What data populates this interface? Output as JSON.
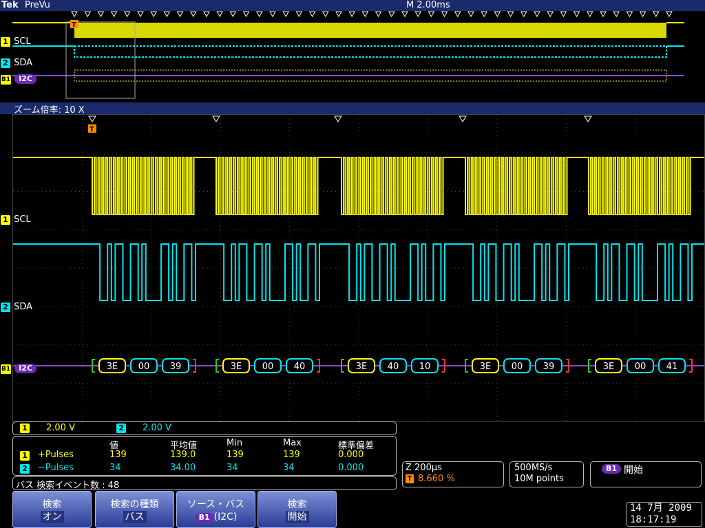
{
  "header": {
    "brand": "Tek",
    "mode": "PreVu",
    "timebase": "M 2.00ms"
  },
  "overview": {
    "ch1_label": "SCL",
    "ch2_label": "SDA",
    "bus_label": "I2C",
    "ch1_num": "1",
    "ch2_num": "2",
    "bus_num": "B1",
    "trigger_marker": "T"
  },
  "zoom": {
    "label": "ズーム倍率: 10 X"
  },
  "main": {
    "ch1_label": "SCL",
    "ch2_label": "SDA",
    "bus_label": "I2C",
    "ch1_num": "1",
    "ch2_num": "2",
    "bus_num": "B1",
    "trigger_marker": "T",
    "packets": [
      [
        "3E",
        "00",
        "39"
      ],
      [
        "3E",
        "00",
        "40"
      ],
      [
        "3E",
        "40",
        "10"
      ],
      [
        "3E",
        "00",
        "39"
      ],
      [
        "3E",
        "00",
        "41"
      ]
    ]
  },
  "scales": {
    "ch1_num": "1",
    "ch1_scale": "2.00 V",
    "ch2_num": "2",
    "ch2_scale": "2.00 V"
  },
  "stats": {
    "headers": {
      "value": "値",
      "mean": "平均値",
      "min": "Min",
      "max": "Max",
      "std": "標準偏差"
    },
    "rows": [
      {
        "num": "1",
        "name": "+Pulses",
        "value": "139",
        "mean": "139.0",
        "min": "139",
        "max": "139",
        "std": "0.000"
      },
      {
        "num": "2",
        "name": "−Pulses",
        "value": "34",
        "mean": "34.00",
        "min": "34",
        "max": "34",
        "std": "0.000"
      }
    ]
  },
  "search_events": "バス 検索イベント数 : 48",
  "zoom_box": {
    "z": "Z 200µs",
    "t_marker": "T",
    "t_pos": "8.660 %"
  },
  "sample_box": {
    "rate": "500MS/s",
    "points": "10M points"
  },
  "bus_box": {
    "bus": "B1",
    "state": "開始"
  },
  "buttons": [
    {
      "line1": "検索",
      "line2": "オン"
    },
    {
      "line1": "検索の種類",
      "line2": "バス"
    },
    {
      "line1": "ソース・バス",
      "bus": "B1",
      "line2": "(I2C)"
    },
    {
      "line1": "検索",
      "line2": "開始"
    }
  ],
  "datetime": {
    "date": "14 7月  2009",
    "time": "18:17:19"
  },
  "colors": {
    "ch1": "#ffff00",
    "ch2": "#00e5ee",
    "bus": "#8a4cd4",
    "trigger": "#ff8c00",
    "header": "#1a2a6a"
  },
  "icons": {
    "trigger": "trigger-marker-icon",
    "search_mark": "search-mark-triangle-icon"
  }
}
